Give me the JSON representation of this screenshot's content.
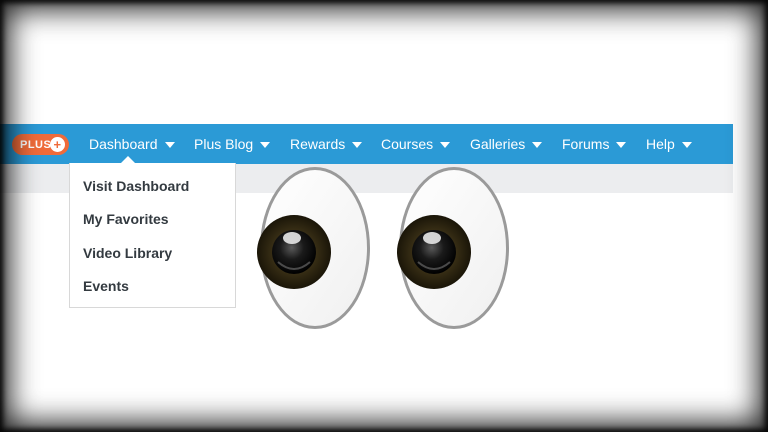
{
  "badge": {
    "label": "PLUS",
    "icon": "plus-circle-icon",
    "color": "#ef6b3a"
  },
  "nav": {
    "color": "#2b9ad6",
    "items": [
      {
        "label": "Dashboard"
      },
      {
        "label": "Plus Blog"
      },
      {
        "label": "Rewards"
      },
      {
        "label": "Courses"
      },
      {
        "label": "Galleries"
      },
      {
        "label": "Forums"
      },
      {
        "label": "Help"
      }
    ]
  },
  "dropdown": {
    "items": [
      {
        "label": "Visit Dashboard"
      },
      {
        "label": "My Favorites"
      },
      {
        "label": "Video Library"
      },
      {
        "label": "Events"
      }
    ]
  },
  "overlay": {
    "icon": "eyes-emoji-icon"
  }
}
